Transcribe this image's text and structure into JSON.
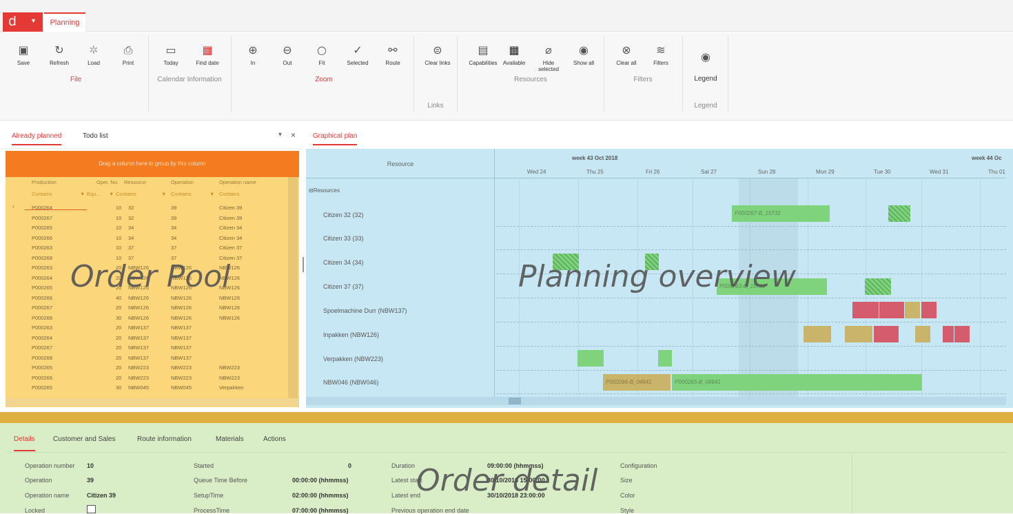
{
  "app": {
    "logo": "d",
    "tab": "Planning"
  },
  "ribbon": {
    "buttons": [
      {
        "label": "Save",
        "icon": "save-icon"
      },
      {
        "label": "Refresh",
        "icon": "refresh-icon"
      },
      {
        "label": "Load",
        "icon": "load-icon"
      },
      {
        "label": "Print",
        "icon": "print-icon"
      },
      {
        "label": "Today",
        "icon": "calendar-icon"
      },
      {
        "label": "Find date",
        "icon": "find-date-icon"
      },
      {
        "label": "In",
        "icon": "zoom-in-icon"
      },
      {
        "label": "Out",
        "icon": "zoom-out-icon"
      },
      {
        "label": "Fit",
        "icon": "search-icon"
      },
      {
        "label": "Selected",
        "icon": "check-circle-icon"
      },
      {
        "label": "Route",
        "icon": "route-icon"
      },
      {
        "label": "Clear links",
        "icon": "unlink-icon"
      },
      {
        "label": "Capabilities",
        "icon": "capabilities-icon"
      },
      {
        "label": "Available",
        "icon": "available-icon"
      },
      {
        "label": "Hide selected",
        "icon": "hide-icon"
      },
      {
        "label": "Show all",
        "icon": "eye-icon"
      },
      {
        "label": "Clear all",
        "icon": "clear-all-icon"
      },
      {
        "label": "Filters",
        "icon": "layers-icon"
      },
      {
        "label": "Legend",
        "icon": "legend-eye-icon"
      }
    ],
    "groups": {
      "file": "File",
      "calendar": "Calendar Information",
      "zoom": "Zoom",
      "links": "Links",
      "resources": "Resources",
      "filters": "Filters",
      "legend": "Legend"
    }
  },
  "left_panel": {
    "tabs": [
      "Already planned",
      "Todo list"
    ],
    "group_hint": "Drag a column here to group by this column",
    "columns": [
      "Production",
      "Oper. No.",
      "Resource",
      "Operation",
      "Operation name"
    ],
    "filters": [
      "Contains",
      "Equ...",
      "Contains",
      "Contains",
      "Contains"
    ],
    "rows": [
      [
        "P000264",
        "10",
        "32",
        "39",
        "Citizen 39"
      ],
      [
        "P000267",
        "10",
        "32",
        "39",
        "Citizen 39"
      ],
      [
        "P000265",
        "10",
        "34",
        "34",
        "Citizen 34"
      ],
      [
        "P000266",
        "10",
        "34",
        "34",
        "Citizen 34"
      ],
      [
        "P000263",
        "10",
        "37",
        "37",
        "Citizen 37"
      ],
      [
        "P000268",
        "10",
        "37",
        "37",
        "Citizen 37"
      ],
      [
        "P000263",
        "20",
        "NBW126",
        "NBW126",
        "NBW126"
      ],
      [
        "P000264",
        "20",
        "NBW126",
        "NBW126",
        "NBW126"
      ],
      [
        "P000265",
        "20",
        "NBW126",
        "NBW126",
        "NBW126"
      ],
      [
        "P000266",
        "40",
        "NBW126",
        "NBW126",
        "NBW126"
      ],
      [
        "P000267",
        "20",
        "NBW126",
        "NBW126",
        "NBW126"
      ],
      [
        "P000268",
        "30",
        "NBW126",
        "NBW126",
        "NBW126"
      ],
      [
        "P000263",
        "20",
        "NBW137",
        "NBW137",
        ""
      ],
      [
        "P000264",
        "20",
        "NBW137",
        "NBW137",
        ""
      ],
      [
        "P000267",
        "20",
        "NBW137",
        "NBW137",
        ""
      ],
      [
        "P000268",
        "20",
        "NBW137",
        "NBW137",
        ""
      ],
      [
        "P000265",
        "20",
        "NBW223",
        "NBW223",
        "NBW223"
      ],
      [
        "P000266",
        "20",
        "NBW223",
        "NBW223",
        "NBW223"
      ],
      [
        "P000265",
        "30",
        "NBW045",
        "NBW045",
        "Verpakken"
      ]
    ],
    "overlay": "Order Pool"
  },
  "right_panel": {
    "tab": "Graphical plan",
    "resource_header": "Resource",
    "weeks": [
      "week 43 Oct 2018",
      "week 44 Oc"
    ],
    "days": [
      "Wed 24",
      "Thu 25",
      "Fri 26",
      "Sat 27",
      "Sun 28",
      "Mon 29",
      "Tue 30",
      "Wed 31",
      "Thu 01"
    ],
    "group": "Resources",
    "resources": [
      "Citizen 32 (32)",
      "Citizen 33 (33)",
      "Citizen 34 (34)",
      "Citizen 37 (37)",
      "Spoelmachine Durr (NBW137)",
      "Inpakken (NBW126)",
      "Verpakken (NBW223)",
      "NBW046 (NBW046)"
    ],
    "bar_labels": [
      "P000267-B_15731",
      "P000263-B_15731",
      "P000266-B_04641",
      "P000265-B_04641"
    ],
    "overlay": "Planning overview"
  },
  "bottom_panel": {
    "tabs": [
      "Details",
      "Customer and Sales",
      "Route information",
      "Materials",
      "Actions"
    ],
    "fields": {
      "operation_number": {
        "label": "Operation number",
        "value": "10"
      },
      "operation": {
        "label": "Operation",
        "value": "39"
      },
      "operation_name": {
        "label": "Operation name",
        "value": "Citizen 39"
      },
      "locked": {
        "label": "Locked"
      },
      "started": {
        "label": "Started",
        "value": "0"
      },
      "queue_time": {
        "label": "Queue Time Before",
        "value": "00:00:00 (hhmmss)"
      },
      "setup_time": {
        "label": "SetupTime",
        "value": "02:00:00 (hhmmss)"
      },
      "process_time": {
        "label": "ProcessTime",
        "value": "07:00:00 (hhmmss)"
      },
      "duration": {
        "label": "Duration",
        "value": "09:00:00 (hhmmss)"
      },
      "latest_start": {
        "label": "Latest start",
        "value": "30/10/2018 15:00:00"
      },
      "latest_end": {
        "label": "Latest end",
        "value": "30/10/2018 23:00:00"
      },
      "prev_end": {
        "label": "Previous operation end date"
      },
      "configuration": {
        "label": "Configuration"
      },
      "size": {
        "label": "Size"
      },
      "color": {
        "label": "Color"
      },
      "style": {
        "label": "Style"
      }
    },
    "overlay": "Order detail"
  }
}
